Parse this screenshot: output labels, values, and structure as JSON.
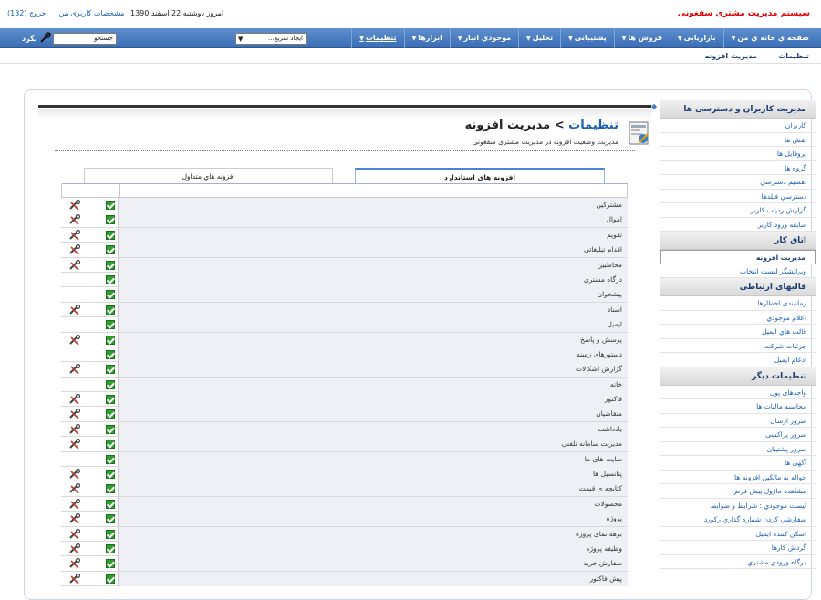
{
  "header": {
    "app_title": "سیستم مدیریت مشتری سفغونی",
    "date_text": "امروز دوشنبه 22 اسفند 1390",
    "user_profile_link": "مشخصات کاربری من",
    "logout_link": "خروج (132)"
  },
  "nav": {
    "items": [
      {
        "label": "صفحه ي خانه ي من",
        "caret": true
      },
      {
        "label": "بازاریابی",
        "caret": true
      },
      {
        "label": "فروش ها",
        "caret": true
      },
      {
        "label": "پشتیبانی",
        "caret": true
      },
      {
        "label": "تحلیل",
        "caret": true
      },
      {
        "label": "موجودي انبار",
        "caret": true
      },
      {
        "label": "ابزارها",
        "caret": true
      },
      {
        "label": "تنظیمات",
        "caret": true,
        "active": true
      }
    ],
    "quick_create": "ایجاد سریع...",
    "search_value": "جستجو",
    "go_label": "بگرد"
  },
  "breadcrumb": {
    "item1": "تنظیمات",
    "item2": "مدیریت افزونه"
  },
  "page": {
    "title_link": "تنظیمات",
    "title_sep": " > ",
    "title_current": "مدیریت افزونه",
    "subtitle": "مدیریت وضعیت افزونه در مدیریت مشتری سفغونی"
  },
  "tabs": {
    "active": "افزونه هاي استاندارد",
    "inactive": "افزونه هاي متداول"
  },
  "modules": [
    {
      "name": "مشترکین",
      "enabled": true,
      "tool": true
    },
    {
      "name": "اموال",
      "enabled": true,
      "tool": true
    },
    {
      "name": "تقویم",
      "enabled": true,
      "tool": true
    },
    {
      "name": "اقدام تبلیغاتی",
      "enabled": true,
      "tool": true
    },
    {
      "name": "مخاطبین",
      "enabled": true,
      "tool": true
    },
    {
      "name": "درگاه مشتری",
      "enabled": true,
      "tool": false
    },
    {
      "name": "پیشخوان",
      "enabled": true,
      "tool": false
    },
    {
      "name": "اسناد",
      "enabled": true,
      "tool": true
    },
    {
      "name": "ایمیل",
      "enabled": true,
      "tool": false
    },
    {
      "name": "پرسش و پاسخ",
      "enabled": true,
      "tool": true
    },
    {
      "name": "دستورهای زمینه",
      "enabled": true,
      "tool": false
    },
    {
      "name": "گزارش اشکالات",
      "enabled": true,
      "tool": true
    },
    {
      "name": "خانه",
      "enabled": true,
      "tool": false
    },
    {
      "name": "فاکتور",
      "enabled": true,
      "tool": true
    },
    {
      "name": "متقاضیان",
      "enabled": true,
      "tool": true
    },
    {
      "name": "یادداشت",
      "enabled": true,
      "tool": true
    },
    {
      "name": "مدیریت سامانه تلفنی",
      "enabled": true,
      "tool": true
    },
    {
      "name": "سایت های ما",
      "enabled": true,
      "tool": false
    },
    {
      "name": "پتانسیل ها",
      "enabled": true,
      "tool": true
    },
    {
      "name": "کتابچه ی قیمت",
      "enabled": true,
      "tool": true
    },
    {
      "name": "محصولات",
      "enabled": true,
      "tool": true
    },
    {
      "name": "پروژه",
      "enabled": true,
      "tool": true
    },
    {
      "name": "برهه نمای پروژه",
      "enabled": true,
      "tool": true
    },
    {
      "name": "وظیفه پروژه",
      "enabled": true,
      "tool": true
    },
    {
      "name": "سفارش خرید",
      "enabled": true,
      "tool": true
    },
    {
      "name": "پیش فاکتور",
      "enabled": true,
      "tool": true
    }
  ],
  "sidebar": {
    "sections": [
      {
        "title": "مدیریت کاربران و دسترسی ها",
        "items": [
          "کاربران",
          "نقش ها",
          "پروفایل ها",
          "گروه ها",
          "تقسیم دسترسي",
          "دسترسي فیلدها",
          "گزارش ردیاب کاربر",
          "سابقه ورود کاربر"
        ]
      },
      {
        "title": "اتاق کار",
        "items": [
          "مدیریت افزونه",
          "ویرایشگر لیست انتخاب"
        ],
        "active_index": 0
      },
      {
        "title": "قالبهای ارتباطی",
        "items": [
          "زمانبندی اخطارها",
          "اعلام موجودي",
          "قالب هاي ایمیل",
          "جزئیات شرکت",
          "ادغام ایمیل"
        ]
      },
      {
        "title": "تنظیمات دیگر",
        "items": [
          "واحدهای پول",
          "محاسبه مالیات ها",
          "سرور ارسال",
          "سرور پراکسی",
          "سرور پشتیبان",
          "آگهی ها",
          "حواله به مالکین افزونه ها",
          "مشاهده ماژول پیش فرض",
          "لیست موجودي : شرایط و ضوابط",
          "سفارشي كردن شماره گذاري ركورد",
          "اسکن کننده ایمیل",
          "گردش کارها",
          "درگاه ورودي مشتري"
        ]
      }
    ]
  },
  "colors": {
    "accent": "#3b6db5",
    "title_red": "#e00000",
    "link": "#1a5fb4",
    "check_green": "#2e9e2e"
  }
}
